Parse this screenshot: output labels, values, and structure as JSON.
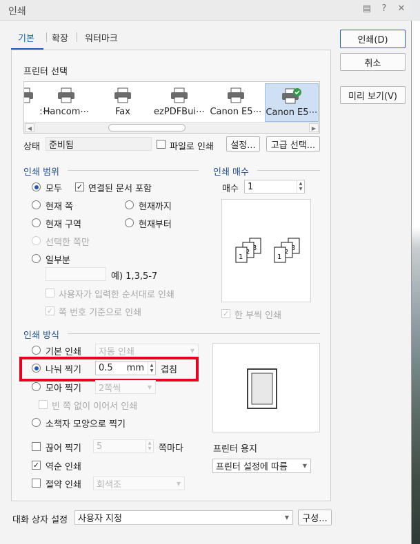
{
  "window": {
    "title": "인쇄",
    "title_icons": [
      "feedback-icon",
      "help-icon",
      "close-icon"
    ]
  },
  "tabs": [
    {
      "label": "기본",
      "active": true
    },
    {
      "label": "확장",
      "active": false
    },
    {
      "label": "워터마크",
      "active": false
    }
  ],
  "side_buttons": {
    "print": "인쇄(D)",
    "cancel": "취소",
    "preview": "미리 보기(V)"
  },
  "printer_select": {
    "title": "프린터 선택",
    "printers": [
      {
        "name": ":⋯",
        "selected": false
      },
      {
        "name": "Hancom⋯",
        "selected": false
      },
      {
        "name": "Fax",
        "selected": false
      },
      {
        "name": "ezPDFBui⋯",
        "selected": false
      },
      {
        "name": "Canon E5⋯",
        "selected": false
      },
      {
        "name": "Canon E5⋯",
        "selected": true
      }
    ]
  },
  "status": {
    "label": "상태",
    "value": "준비됨",
    "print_to_file": "파일로 인쇄",
    "settings_button": "설정...",
    "advanced_button": "고급 선택..."
  },
  "print_range": {
    "title": "인쇄 범위",
    "all": "모두",
    "include_linked": "연결된 문서 포함",
    "current_page": "현재 쪽",
    "to_current": "현재까지",
    "current_section": "현재 구역",
    "from_current": "현재부터",
    "selected_pages": "선택한 쪽만",
    "partial": "일부분",
    "partial_value": "",
    "example": "예) 1,3,5-7",
    "in_user_order": "사용자가 입력한 순서대로 인쇄",
    "by_page_number": "쪽 번호 기준으로 인쇄"
  },
  "copies": {
    "title": "인쇄 매수",
    "label": "매수",
    "value": "1",
    "collate": "한 부씩 인쇄"
  },
  "print_method": {
    "title": "인쇄 방식",
    "basic": "기본 인쇄",
    "basic_option": "자동 인쇄",
    "split": "나눠 찍기",
    "split_value": "0.5",
    "split_unit": "mm",
    "overlap": "겹침",
    "gather": "모아 찍기",
    "gather_option": "2쪽씩",
    "continuous": "빈 쪽 없이 이어서 인쇄",
    "booklet": "소책자 모양으로 찍기",
    "chunk": "끊어 찍기",
    "chunk_value": "5",
    "chunk_unit": "쪽마다",
    "reverse": "역순 인쇄",
    "economy": "절약 인쇄",
    "economy_option": "회색조"
  },
  "printer_paper": {
    "title": "프린터 용지",
    "value": "프린터 설정에 따름"
  },
  "dialog_settings": {
    "label": "대화 상자 설정",
    "value": "사용자 지정",
    "config_button": "구성..."
  },
  "collate_preview_numbers": [
    "1",
    "2",
    "3",
    "1",
    "2",
    "3"
  ]
}
